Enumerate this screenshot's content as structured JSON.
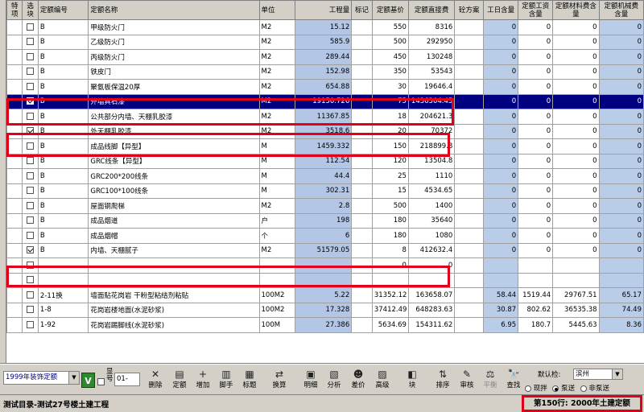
{
  "columns": {
    "tx": "特项",
    "xk": "选块",
    "code": "定额编号",
    "name": "定额名称",
    "unit": "单位",
    "qty": "工程量",
    "mark": "标记",
    "price": "定额基价",
    "direct": "定额直接费",
    "plan": "砼方案",
    "workday": "工日含量",
    "labor": "定额工资含量",
    "material": "定额材料费含量",
    "machine": "定额机械费含量"
  },
  "rows": [
    {
      "checked": false,
      "selected": false,
      "code": "B",
      "name": "甲级防火门",
      "unit": "M2",
      "qty": "15.12",
      "price": "550",
      "direct": "8316",
      "workday": "0",
      "labor": "0",
      "material": "0",
      "machine": "0"
    },
    {
      "checked": false,
      "selected": false,
      "code": "B",
      "name": "乙级防火门",
      "unit": "M2",
      "qty": "585.9",
      "price": "500",
      "direct": "292950",
      "workday": "0",
      "labor": "0",
      "material": "0",
      "machine": "0"
    },
    {
      "checked": false,
      "selected": false,
      "code": "B",
      "name": "丙级防火门",
      "unit": "M2",
      "qty": "289.44",
      "price": "450",
      "direct": "130248",
      "workday": "0",
      "labor": "0",
      "material": "0",
      "machine": "0"
    },
    {
      "checked": false,
      "selected": false,
      "code": "B",
      "name": "铁皮门",
      "unit": "M2",
      "qty": "152.98",
      "price": "350",
      "direct": "53543",
      "workday": "0",
      "labor": "0",
      "material": "0",
      "machine": "0"
    },
    {
      "checked": false,
      "selected": false,
      "code": "B",
      "name": "聚氨板保温20厚",
      "unit": "M2",
      "qty": "654.88",
      "price": "30",
      "direct": "19646.4",
      "workday": "0",
      "labor": "0",
      "material": "0",
      "machine": "0"
    },
    {
      "checked": true,
      "selected": true,
      "code": "B",
      "name": "外墙真石漆",
      "unit": "M2",
      "qty": "19150.726",
      "price": "75",
      "direct": "1436304.45",
      "workday": "0",
      "labor": "0",
      "material": "0",
      "machine": "0"
    },
    {
      "checked": false,
      "selected": false,
      "code": "B",
      "name": "公共部分内墙、天棚乳胶漆",
      "unit": "M2",
      "qty": "11367.85",
      "price": "18",
      "direct": "204621.3",
      "workday": "0",
      "labor": "0",
      "material": "0",
      "machine": "0"
    },
    {
      "checked": true,
      "selected": false,
      "code": "B",
      "name": "外天棚乳胶漆",
      "unit": "M2",
      "qty": "3518.6",
      "price": "20",
      "direct": "70372",
      "workday": "0",
      "labor": "0",
      "material": "0",
      "machine": "0"
    },
    {
      "checked": false,
      "selected": false,
      "code": "B",
      "name": "成品线脚【异型】",
      "unit": "M",
      "qty": "1459.332",
      "price": "150",
      "direct": "218899.8",
      "workday": "0",
      "labor": "0",
      "material": "0",
      "machine": "0"
    },
    {
      "checked": false,
      "selected": false,
      "code": "B",
      "name": "GRC线条【异型】",
      "unit": "M",
      "qty": "112.54",
      "price": "120",
      "direct": "13504.8",
      "workday": "0",
      "labor": "0",
      "material": "0",
      "machine": "0"
    },
    {
      "checked": false,
      "selected": false,
      "code": "B",
      "name": "GRC200*200线条",
      "unit": "M",
      "qty": "44.4",
      "price": "25",
      "direct": "1110",
      "workday": "0",
      "labor": "0",
      "material": "0",
      "machine": "0"
    },
    {
      "checked": false,
      "selected": false,
      "code": "B",
      "name": "GRC100*100线条",
      "unit": "M",
      "qty": "302.31",
      "price": "15",
      "direct": "4534.65",
      "workday": "0",
      "labor": "0",
      "material": "0",
      "machine": "0"
    },
    {
      "checked": false,
      "selected": false,
      "code": "B",
      "name": "屋面钢爬梯",
      "unit": "M2",
      "qty": "2.8",
      "price": "500",
      "direct": "1400",
      "workday": "0",
      "labor": "0",
      "material": "0",
      "machine": "0"
    },
    {
      "checked": false,
      "selected": false,
      "code": "B",
      "name": "成品烟道",
      "unit": "户",
      "qty": "198",
      "price": "180",
      "direct": "35640",
      "workday": "0",
      "labor": "0",
      "material": "0",
      "machine": "0"
    },
    {
      "checked": false,
      "selected": false,
      "code": "B",
      "name": "成品烟帽",
      "unit": "个",
      "qty": "6",
      "price": "180",
      "direct": "1080",
      "workday": "0",
      "labor": "0",
      "material": "0",
      "machine": "0"
    },
    {
      "checked": true,
      "selected": false,
      "code": "B",
      "name": "内墙、天棚腻子",
      "unit": "M2",
      "qty": "51579.05",
      "price": "8",
      "direct": "412632.4",
      "workday": "0",
      "labor": "0",
      "material": "0",
      "machine": "0"
    },
    {
      "checked": false,
      "selected": false,
      "code": "",
      "name": "",
      "unit": "",
      "qty": "",
      "price": "0",
      "direct": "0",
      "workday": "",
      "labor": "",
      "material": "",
      "machine": ""
    },
    {
      "checked": false,
      "selected": false,
      "code": "",
      "name": "",
      "unit": "",
      "qty": "",
      "price": "",
      "direct": "",
      "workday": "",
      "labor": "",
      "material": "",
      "machine": ""
    },
    {
      "checked": false,
      "selected": false,
      "code": "2-11换",
      "name": "墙面贴花岗岩 干粉型粘结剂粘贴",
      "unit": "100M2",
      "qty": "5.22",
      "price": "31352.12",
      "direct": "163658.07",
      "workday": "58.44",
      "labor": "1519.44",
      "material": "29767.51",
      "machine": "65.17"
    },
    {
      "checked": false,
      "selected": false,
      "code": "1-8",
      "name": "花岗岩楼地面(水泥砂浆)",
      "unit": "100M2",
      "qty": "17.328",
      "price": "37412.49",
      "direct": "648283.63",
      "workday": "30.87",
      "labor": "802.62",
      "material": "36535.38",
      "machine": "74.49"
    },
    {
      "checked": false,
      "selected": false,
      "code": "1-92",
      "name": "花岗岩踢脚线(水泥砂浆)",
      "unit": "100M",
      "qty": "27.386",
      "price": "5634.69",
      "direct": "154311.62",
      "workday": "6.95",
      "labor": "180.7",
      "material": "5445.63",
      "machine": "8.36"
    }
  ],
  "toolbar": {
    "db_select": "1999年装饰定额",
    "v_label": "V",
    "code_label": "显号",
    "code_value": "01-",
    "buttons": [
      "删除",
      "定额",
      "增加",
      "脚手",
      "标题",
      "换算",
      "明细",
      "分析",
      "差价",
      "高级",
      "块",
      "排序",
      "审核",
      "平衡",
      "查找"
    ],
    "default_label": "默认检:",
    "default_value": "滨州",
    "radio_1": "现拌",
    "radio_2": "泵送",
    "radio_3": "非泵送"
  },
  "status": {
    "left": "测试目录-测试27号楼土建工程",
    "right": "第150行: 2000年土建定额"
  }
}
